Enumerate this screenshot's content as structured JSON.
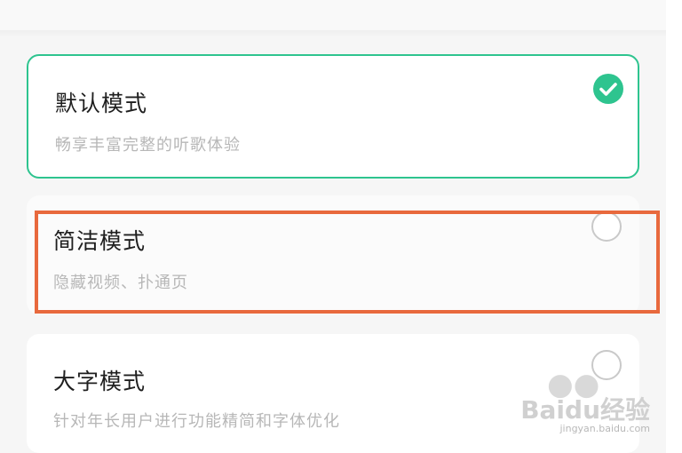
{
  "modes": [
    {
      "title": "默认模式",
      "description": "畅享丰富完整的听歌体验",
      "selected": true,
      "icon": "check-icon"
    },
    {
      "title": "简洁模式",
      "description": "隐藏视频、扑通页",
      "selected": false,
      "icon": "radio-icon"
    },
    {
      "title": "大字模式",
      "description": "针对年长用户进行功能精简和字体优化",
      "selected": false,
      "icon": "radio-icon"
    }
  ],
  "colors": {
    "accent": "#2ec48f",
    "highlight": "#e8693d",
    "title_text": "#1f1f1f",
    "desc_text": "#b7b7b7",
    "background": "#f6f6f6"
  },
  "watermark": {
    "line1": "Baidu经验",
    "line2": "jingyan.baidu.com"
  }
}
